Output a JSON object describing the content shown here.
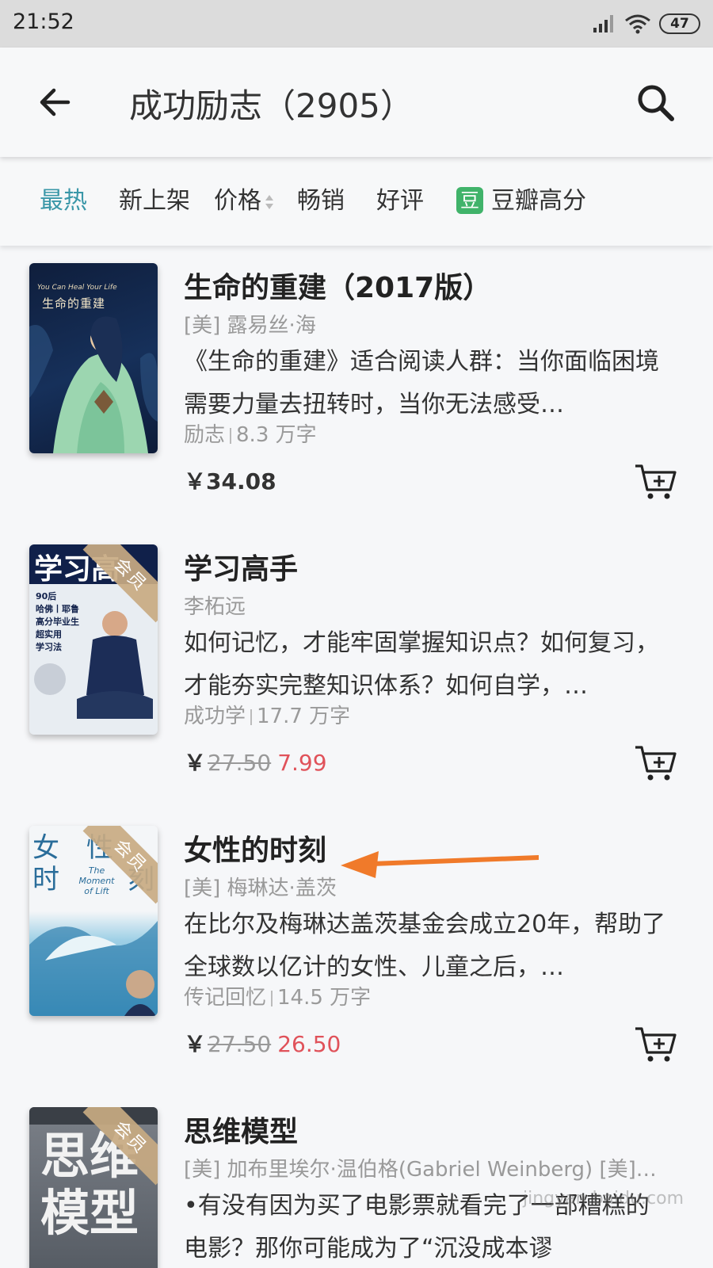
{
  "status_bar": {
    "time": "21:52",
    "battery": "47"
  },
  "header": {
    "title": "成功励志（2905）"
  },
  "filters": [
    {
      "label": "最热"
    },
    {
      "label": "新上架"
    },
    {
      "label": "价格"
    },
    {
      "label": "畅销"
    },
    {
      "label": "好评"
    },
    {
      "label": "豆瓣高分",
      "icon_text": "豆"
    }
  ],
  "vip_label": "会员",
  "currency": "￥",
  "books": [
    {
      "title": "生命的重建（2017版）",
      "author": "[美] 露易丝·海",
      "desc": "《生命的重建》适合阅读人群：当你面临困境需要力量去扭转时，当你无法感受…",
      "category": "励志",
      "words": "8.3 万字",
      "price": "34.08",
      "cover_title": "生命的重建",
      "cover_en": "You Can Heal Your Life"
    },
    {
      "title": "学习高手",
      "author": "李柘远",
      "desc": "如何记忆，才能牢固掌握知识点？如何复习，才能夯实完整知识体系？如何自学，…",
      "category": "成功学",
      "words": "17.7 万字",
      "old_price": "27.50",
      "sale_price": "7.99",
      "cover_title": "学习高",
      "cover_tags": [
        "90后",
        "哈佛丨耶鲁",
        "高分毕业生",
        "超实用",
        "学习法"
      ]
    },
    {
      "title": "女性的时刻",
      "author": "[美] 梅琳达·盖茨",
      "desc": "在比尔及梅琳达盖茨基金会成立20年，帮助了全球数以亿计的女性、儿童之后，…",
      "category": "传记回忆",
      "words": "14.5 万字",
      "old_price": "27.50",
      "sale_price": "26.50",
      "cover_chars": [
        "女",
        "性",
        "时",
        "刻"
      ],
      "cover_en": "The Moment of Lift"
    },
    {
      "title": "思维模型",
      "author": "[美] 加布里埃尔·温伯格(Gabriel Weinberg) [美]…",
      "desc": "•有没有因为买了电影票就看完了一部糟糕的电影？那你可能成为了“沉没成本谬",
      "cover_chars": [
        "思",
        "维",
        "模",
        "型"
      ]
    }
  ],
  "watermark": "jingyan.baidu.com"
}
